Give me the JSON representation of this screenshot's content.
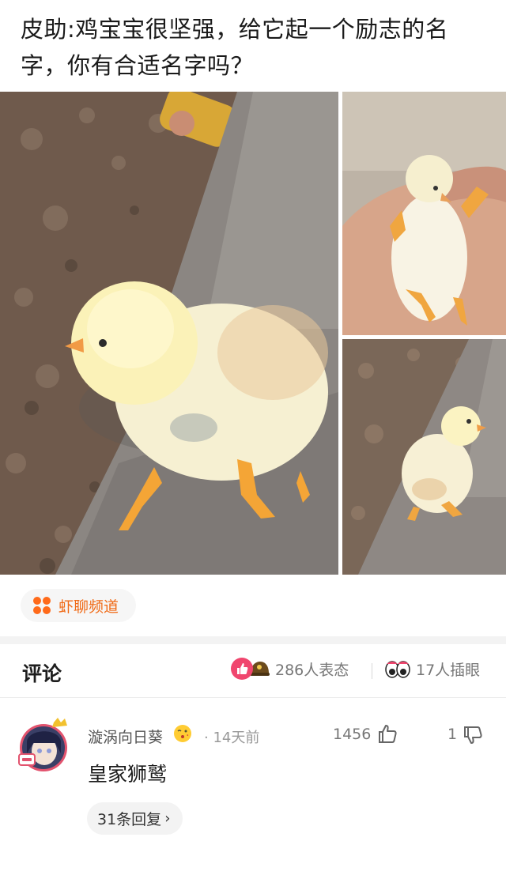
{
  "post": {
    "title": "皮助:鸡宝宝很坚强，给它起一个励志的名字，你有合适名字吗？"
  },
  "gallery": {
    "photos": [
      "chick-on-log",
      "chick-in-hand",
      "chick-on-log-side"
    ]
  },
  "channel": {
    "label": "虾聊频道",
    "icon": "four-dots-icon",
    "color": "#f06a16"
  },
  "comments_section": {
    "title": "评论",
    "reactions_text": "286人表态",
    "eye_roll_text": "17人插眼"
  },
  "comment": {
    "username": "漩涡向日葵",
    "time": "14天前",
    "like_count": "1456",
    "dislike_count": "1",
    "text": "皇家狮鹫",
    "replies_label": "31条回复",
    "replies_chevron": "›"
  },
  "colors": {
    "accent": "#f06a16",
    "like": "#f0466e"
  }
}
